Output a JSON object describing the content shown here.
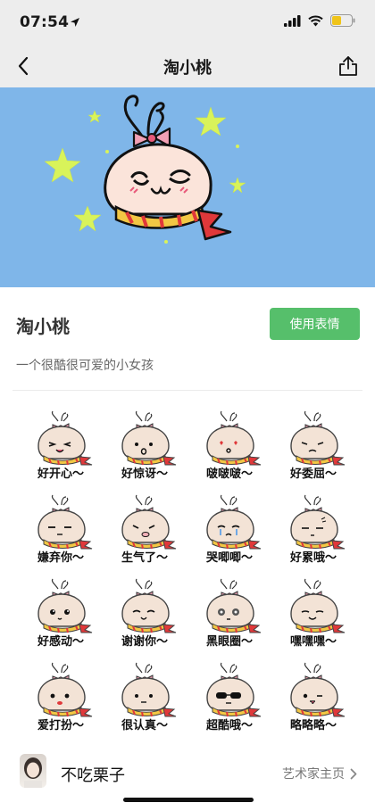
{
  "status_bar": {
    "time": "07:54"
  },
  "nav": {
    "title": "淘小桃"
  },
  "pack": {
    "name": "淘小桃",
    "use_button_label": "使用表情",
    "description": "一个很酷很可爱的小女孩"
  },
  "stickers": [
    {
      "caption": "好开心～",
      "face": "happy"
    },
    {
      "caption": "好惊讶～",
      "face": "surprised"
    },
    {
      "caption": "啵啵啵～",
      "face": "hearts"
    },
    {
      "caption": "好委屈～",
      "face": "wronged"
    },
    {
      "caption": "嫌弃你～",
      "face": "disdain"
    },
    {
      "caption": "生气了～",
      "face": "angry"
    },
    {
      "caption": "哭唧唧～",
      "face": "crying"
    },
    {
      "caption": "好累哦～",
      "face": "tired"
    },
    {
      "caption": "好感动～",
      "face": "moved"
    },
    {
      "caption": "谢谢你～",
      "face": "thanks"
    },
    {
      "caption": "黑眼圈～",
      "face": "darkcircles"
    },
    {
      "caption": "嘿嘿嘿～",
      "face": "hehe"
    },
    {
      "caption": "爱打扮～",
      "face": "makeup"
    },
    {
      "caption": "很认真～",
      "face": "serious"
    },
    {
      "caption": "超酷哦～",
      "face": "cool"
    },
    {
      "caption": "略略略～",
      "face": "tongue"
    }
  ],
  "artist": {
    "name": "不吃栗子",
    "link_label": "艺术家主页"
  },
  "icons": {
    "back": "chevron-left-icon",
    "share": "share-icon",
    "location": "location-arrow-icon",
    "signal": "signal-icon",
    "wifi": "wifi-icon",
    "battery": "battery-icon",
    "chevron": "chevron-right-icon"
  },
  "colors": {
    "banner": "#7fb6e9",
    "use_button": "#56bf6b",
    "star": "#d9f35a",
    "bow": "#e85a7a",
    "scarf_red": "#e0383a",
    "scarf_yellow": "#f2c744"
  }
}
